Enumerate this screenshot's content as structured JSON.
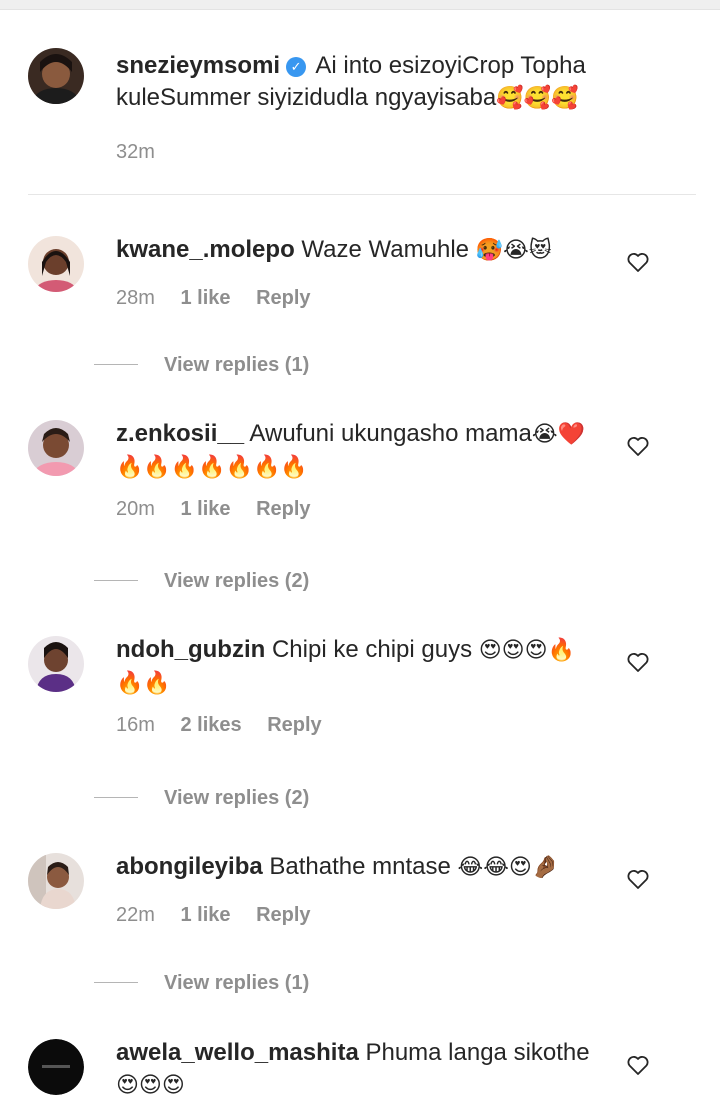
{
  "post": {
    "username": "snezieymsomi",
    "text": "Ai into esizoyiCrop Topha kuleSummer siyizidudla ngyayisaba",
    "emojis": "🥰🥰🥰",
    "time": "32m"
  },
  "comments": [
    {
      "username": "kwane_.molepo",
      "text": "Waze Wamuhle",
      "emojis": "🥵😭😻",
      "time": "28m",
      "likes": "1 like",
      "reply": "Reply",
      "view_replies": "View replies (1)"
    },
    {
      "username": "z.enkosii__",
      "text": "Awufuni ukungasho mama",
      "emojis": "😭❤️",
      "emojis2": "🔥🔥🔥🔥🔥🔥🔥",
      "time": "20m",
      "likes": "1 like",
      "reply": "Reply",
      "view_replies": "View replies (2)"
    },
    {
      "username": "ndoh_gubzin",
      "text": "Chipi ke chipi guys",
      "emojis": "😍😍😍🔥",
      "emojis2": "🔥🔥",
      "time": "16m",
      "likes": "2 likes",
      "reply": "Reply",
      "view_replies": "View replies (2)"
    },
    {
      "username": "abongileyiba",
      "text": "Bathathe mntase",
      "emojis": "😂😂😍🤌🏾",
      "time": "22m",
      "likes": "1 like",
      "reply": "Reply",
      "view_replies": "View replies (1)"
    },
    {
      "username": "awela_wello_mashita",
      "text": "Phuma langa sikothe",
      "emojis2": "😍😍😍"
    }
  ],
  "colors": {
    "secondary_text": "#8e8e8e",
    "verified_blue": "#3897f0"
  },
  "icons": {
    "like": "heart-outline-icon",
    "verified": "verified-badge-icon"
  }
}
